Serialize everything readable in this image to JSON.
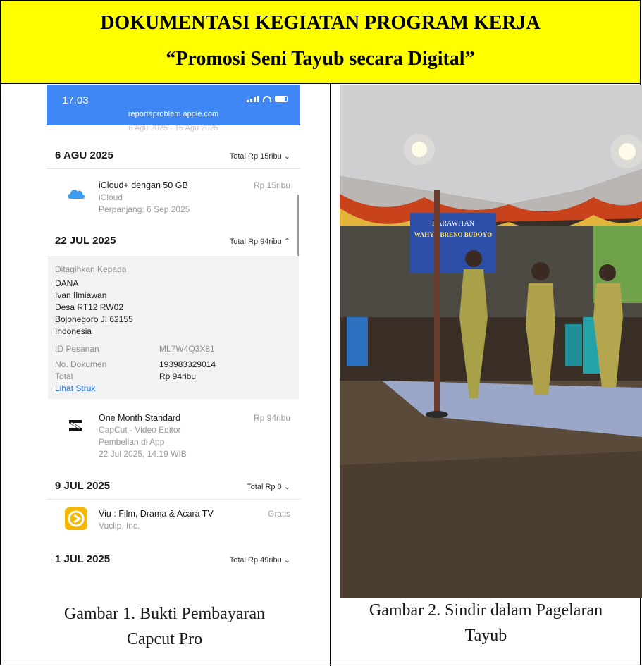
{
  "header": {
    "title": "DOKUMENTASI KEGIATAN PROGRAM KERJA",
    "subtitle": "“Promosi Seni Tayub secara Digital”"
  },
  "colors": {
    "header_bg": "#ffff00",
    "phone_bar": "#3f87f5",
    "link": "#1b6fd3"
  },
  "left_figure": {
    "screenshot": {
      "status_time": "17.03",
      "url": "reportaproblem.apple.com",
      "clipped_text": "6 Agu 2025 - 15 Agu 2025",
      "sections": [
        {
          "date": "6 AGU 2025",
          "total": "Total Rp 15ribu ⌄",
          "items": [
            {
              "icon": "icloud-icon",
              "name": "iCloud+ dengan 50 GB",
              "line1": "iCloud",
              "line2": "Perpanjang: 6 Sep 2025",
              "price": "Rp 15ribu"
            }
          ]
        },
        {
          "date": "22 JUL 2025",
          "total": "Total Rp 94ribu ⌃",
          "invoice": {
            "billed_to_label": "Ditagihkan Kepada",
            "address": [
              "DANA",
              "Ivan Ilmiawan",
              "Desa RT12 RW02",
              "Bojonegoro JI 62155",
              "Indonesia"
            ],
            "order_id_label": "ID Pesanan",
            "order_id": "ML7W4Q3X81",
            "doc_no_label": "No. Dokumen",
            "doc_no": "193983329014",
            "total_label": "Total",
            "total_value": "Rp 94ribu",
            "receipt_link": "Lihat Struk"
          },
          "items": [
            {
              "icon": "capcut-icon",
              "name": "One Month Standard",
              "line1": "CapCut - Video Editor",
              "line2": "Pembelian di App",
              "line3": "22 Jul 2025, 14.19 WIB",
              "price": "Rp 94ribu"
            }
          ]
        },
        {
          "date": "9 JUL 2025",
          "total": "Total Rp 0 ⌄",
          "items": [
            {
              "icon": "viu-icon",
              "name": "Viu : Film, Drama & Acara TV",
              "line1": "Vuclip, Inc.",
              "price": "Gratis"
            }
          ]
        },
        {
          "date": "1 JUL 2025",
          "total": "Total Rp 49ribu ⌄"
        }
      ]
    },
    "caption_line1": "Gambar 1. Bukti Pembayaran",
    "caption_line2": "Capcut Pro"
  },
  "right_figure": {
    "banner_text": "KARAWITAN",
    "banner_name": "WAHYU BRENO BUDOYO",
    "caption_line1": "Gambar 2. Sindir dalam Pagelaran",
    "caption_line2": "Tayub"
  }
}
